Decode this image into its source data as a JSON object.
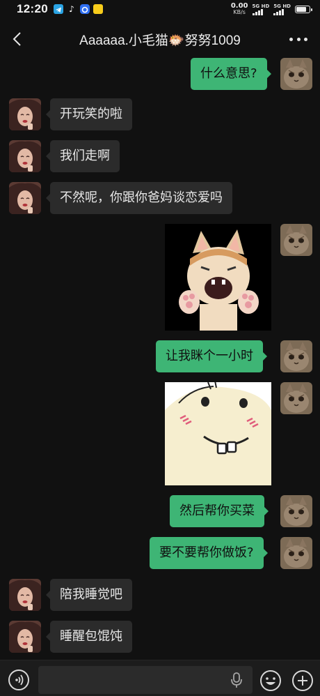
{
  "status_bar": {
    "time": "12:20",
    "net_speed_value": "0.00",
    "net_speed_unit": "KB/s",
    "sim1_label": "5G HD",
    "sim2_label": "5G HD",
    "battery_level": 0.85
  },
  "header": {
    "title": "Aaaaaa.小毛猫🐡努努1009"
  },
  "messages": [
    {
      "side": "out",
      "type": "text",
      "text": "什么意思?"
    },
    {
      "side": "in",
      "type": "text",
      "text": "开玩笑的啦"
    },
    {
      "side": "in",
      "type": "text",
      "text": "我们走啊"
    },
    {
      "side": "in",
      "type": "text",
      "text": "不然呢，你跟你爸妈谈恋爱吗"
    },
    {
      "side": "out",
      "type": "sticker",
      "sticker": "laughing-cat-sticker"
    },
    {
      "side": "out",
      "type": "text",
      "text": "让我眯个一小时"
    },
    {
      "side": "out",
      "type": "sticker",
      "sticker": "bucktooth-face-sticker"
    },
    {
      "side": "out",
      "type": "text",
      "text": "然后帮你买菜"
    },
    {
      "side": "out",
      "type": "text",
      "text": "要不要帮你做饭?"
    },
    {
      "side": "in",
      "type": "text",
      "text": "陪我睡觉吧"
    },
    {
      "side": "in",
      "type": "text",
      "text": "睡醒包馄饨"
    }
  ],
  "input_bar": {
    "placeholder": "",
    "value": ""
  },
  "colors": {
    "background": "#111111",
    "bubble_in": "#2b2b2b",
    "bubble_out": "#3eb575",
    "input_bar": "#1c1c1c"
  },
  "icons": [
    "back-arrow-icon",
    "more-dots-icon",
    "voice-icon",
    "mic-icon",
    "emoji-icon",
    "plus-icon"
  ]
}
